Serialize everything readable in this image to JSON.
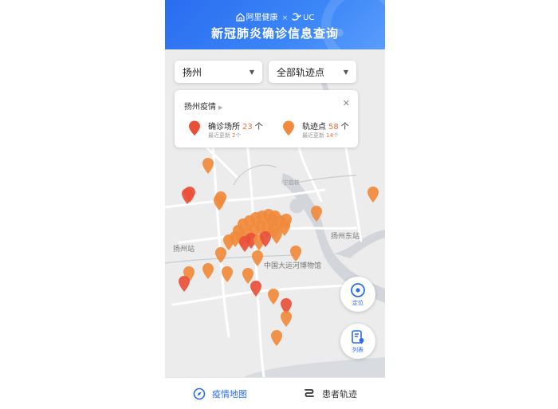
{
  "header": {
    "brand_left": "阿里健康",
    "brand_sep": "×",
    "brand_right": "UC",
    "title": "新冠肺炎确诊信息查询"
  },
  "filters": {
    "city": "扬州",
    "track_filter": "全部轨迹点"
  },
  "info_card": {
    "title": "扬州疫情",
    "confirmed": {
      "label": "确诊场所",
      "count": "23",
      "unit": "个",
      "recent_prefix": "最近更新",
      "recent_count": "2",
      "recent_unit": "个"
    },
    "tracks": {
      "label": "轨迹点",
      "count": "58",
      "unit": "个",
      "recent_prefix": "最近更新",
      "recent_count": "14",
      "recent_unit": "个"
    }
  },
  "map_labels": {
    "station": "扬州站",
    "east_station": "扬州东站",
    "museum": "中国大运河博物馆",
    "road": "宁启铁"
  },
  "fab": {
    "locate_label": "定位",
    "list_label": "列表"
  },
  "bottom_nav": {
    "tab_map": "疫情地图",
    "tab_tracks": "患者轨迹"
  },
  "colors": {
    "header": "#2a6cf0",
    "accent": "#2a6cf0",
    "confirmed_pin": "#e8503a",
    "track_pin": "#f08a3c",
    "count_text": "#f26b3a"
  }
}
